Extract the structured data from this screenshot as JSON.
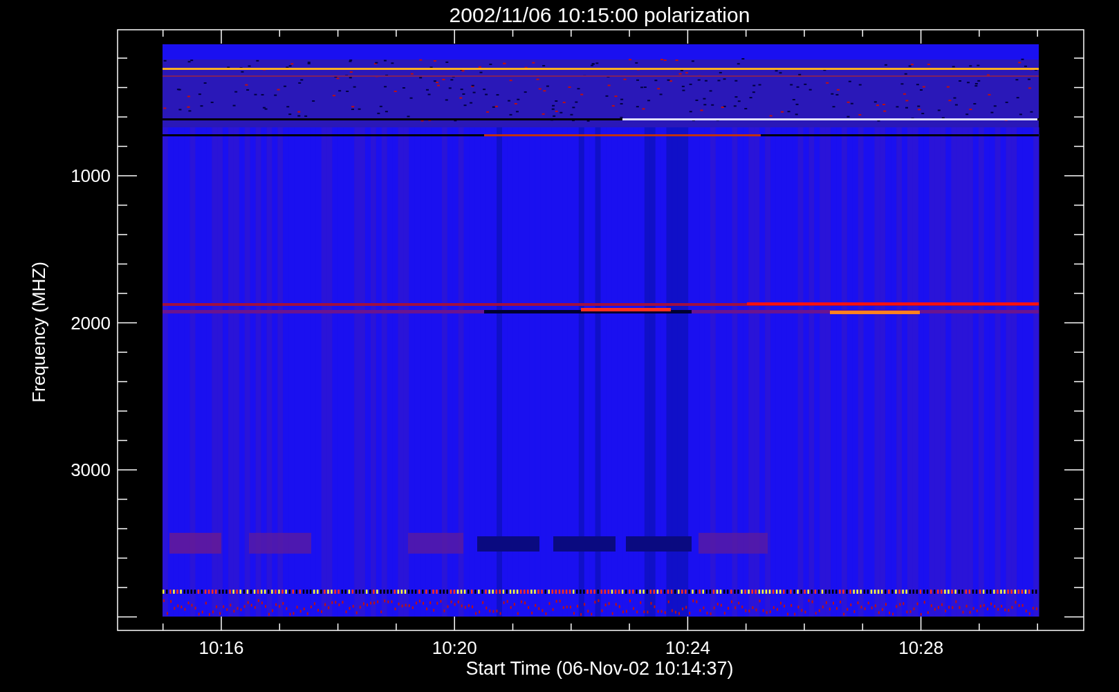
{
  "plot": {
    "title": "2002/11/06 10:15:00 polarization",
    "xlabel": "Start Time (06-Nov-02 10:14:37)",
    "ylabel": "Frequency (MHZ)",
    "xticks": [
      "10:16",
      "10:20",
      "10:24",
      "10:28"
    ],
    "yticks": [
      "1000",
      "2000",
      "3000"
    ]
  }
}
